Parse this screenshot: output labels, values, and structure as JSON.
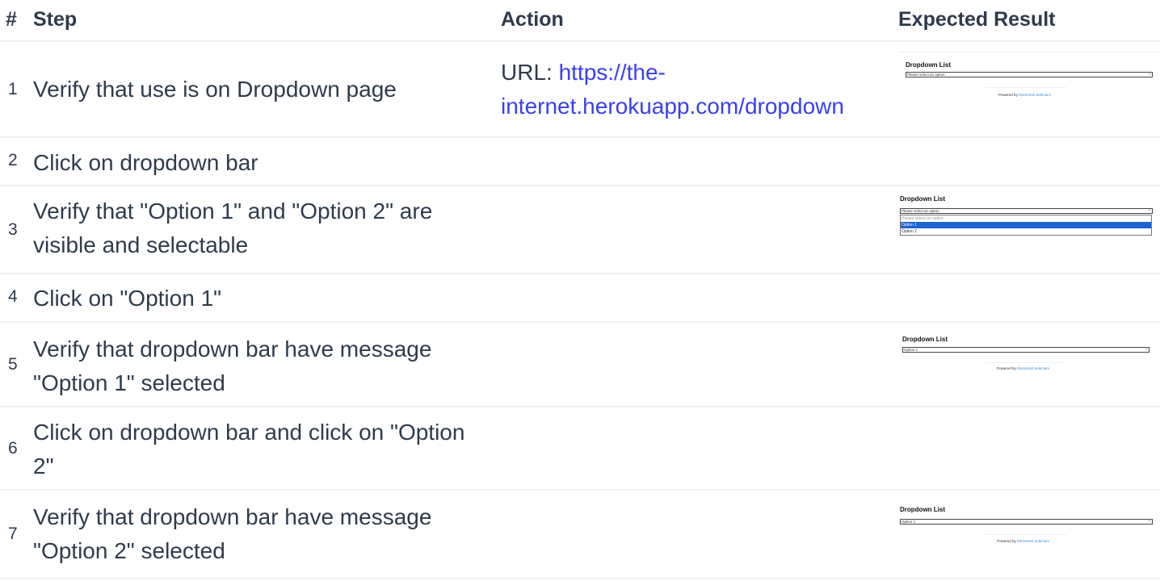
{
  "header": {
    "num": "#",
    "step": "Step",
    "action": "Action",
    "expected": "Expected Result"
  },
  "rows": [
    {
      "num": "1",
      "step": "Verify that use is on Dropdown page",
      "action_prefix": "URL: ",
      "action_link": "https://the-internet.herokuapp.com/dropdown"
    },
    {
      "num": "2",
      "step": "Click on dropdown bar"
    },
    {
      "num": "3",
      "step": "Verify that \"Option 1\" and \"Option 2\" are visible and selectable"
    },
    {
      "num": "4",
      "step": "Click on \"Option 1\""
    },
    {
      "num": "5",
      "step": "Verify that dropdown bar have message \"Option 1\" selected"
    },
    {
      "num": "6",
      "step": "Click on dropdown bar and click on \"Option 2\""
    },
    {
      "num": "7",
      "step": "Verify that dropdown bar have message \"Option 2\" selected"
    }
  ],
  "thumbs": {
    "t1": {
      "title": "Dropdown List",
      "select": "Please select an option",
      "powered_prefix": "Powered by ",
      "powered_link": "Elemental Selenium"
    },
    "t3": {
      "title": "Dropdown List",
      "select": "Please select an option",
      "options": [
        "Please select an option",
        "Option 1",
        "Option 2"
      ]
    },
    "t5": {
      "title": "Dropdown List",
      "select": "Option 1",
      "powered_prefix": "Powered by ",
      "powered_link": "Elemental Selenium"
    },
    "t7": {
      "title": "Dropdown List",
      "select": "Option 2",
      "powered_prefix": "Powered by ",
      "powered_link": "Elemental Selenium"
    }
  },
  "colors": {
    "text": "#2f3b4c",
    "link": "#3a3ff0",
    "divider": "#eef0f3",
    "highlight": "#1f62d2"
  }
}
